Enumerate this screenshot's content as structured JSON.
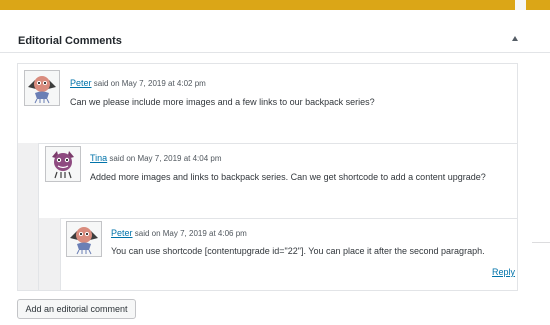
{
  "panel": {
    "title": "Editorial Comments",
    "toggle_icon": "arrow-up-icon"
  },
  "comments": [
    {
      "author": "Peter",
      "said_on": "said on May 7, 2019 at 4:02 pm",
      "text": "Can we please include more images and a few links to our backpack series?",
      "avatar_icon": "bat-avatar-icon"
    },
    {
      "author": "Tina",
      "said_on": "said on May 7, 2019 at 4:04 pm",
      "text": "Added more images and links to backpack series. Can we get shortcode to add a content upgrade?",
      "avatar_icon": "monster-avatar-icon"
    },
    {
      "author": "Peter",
      "said_on": "said on May 7, 2019 at 4:06 pm",
      "text": "You can use shortcode [contentupgrade id=\"22\"]. You can place it after the second paragraph.",
      "avatar_icon": "bat-avatar-icon"
    }
  ],
  "reply_label": "Reply",
  "add_button_label": "Add an editorial comment",
  "colors": {
    "accent_bar": "#dba617",
    "link": "#0073aa",
    "border": "#e2e4e7"
  }
}
